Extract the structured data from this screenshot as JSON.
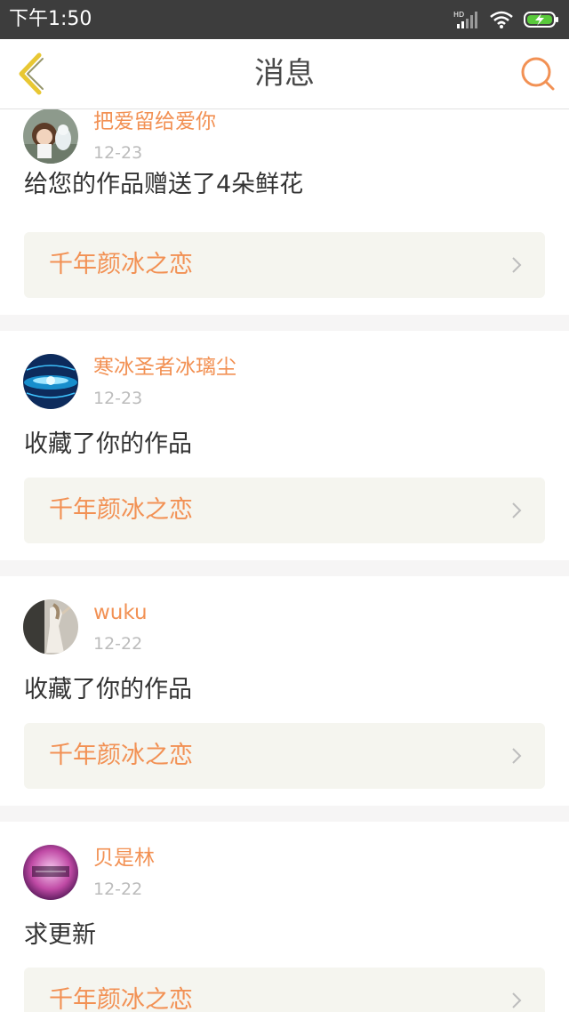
{
  "status_bar": {
    "time": "下午1:50",
    "icons": [
      "hd-signal-icon",
      "wifi-icon",
      "battery-charging-icon"
    ],
    "hd_label": "HD"
  },
  "nav": {
    "title": "消息",
    "back_icon": "chevron-left-icon",
    "search_icon": "search-icon"
  },
  "colors": {
    "accent": "#f29154",
    "back_icon": "#e8c733",
    "status_bar_bg": "#3d3d3d",
    "work_box_bg": "#f5f5ef",
    "divider_bg": "#f6f5f5"
  },
  "messages": [
    {
      "username": "把爱留给爱你",
      "date": "12-23",
      "text": "给您的作品赠送了4朵鲜花",
      "work_title": "千年颜冰之恋"
    },
    {
      "username": "寒冰圣者冰璃尘",
      "date": "12-23",
      "text": "收藏了你的作品",
      "work_title": "千年颜冰之恋"
    },
    {
      "username": "wuku",
      "date": "12-22",
      "text": "收藏了你的作品",
      "work_title": "千年颜冰之恋"
    },
    {
      "username": "贝是林",
      "date": "12-22",
      "text": "求更新",
      "work_title": "千年颜冰之恋"
    }
  ]
}
